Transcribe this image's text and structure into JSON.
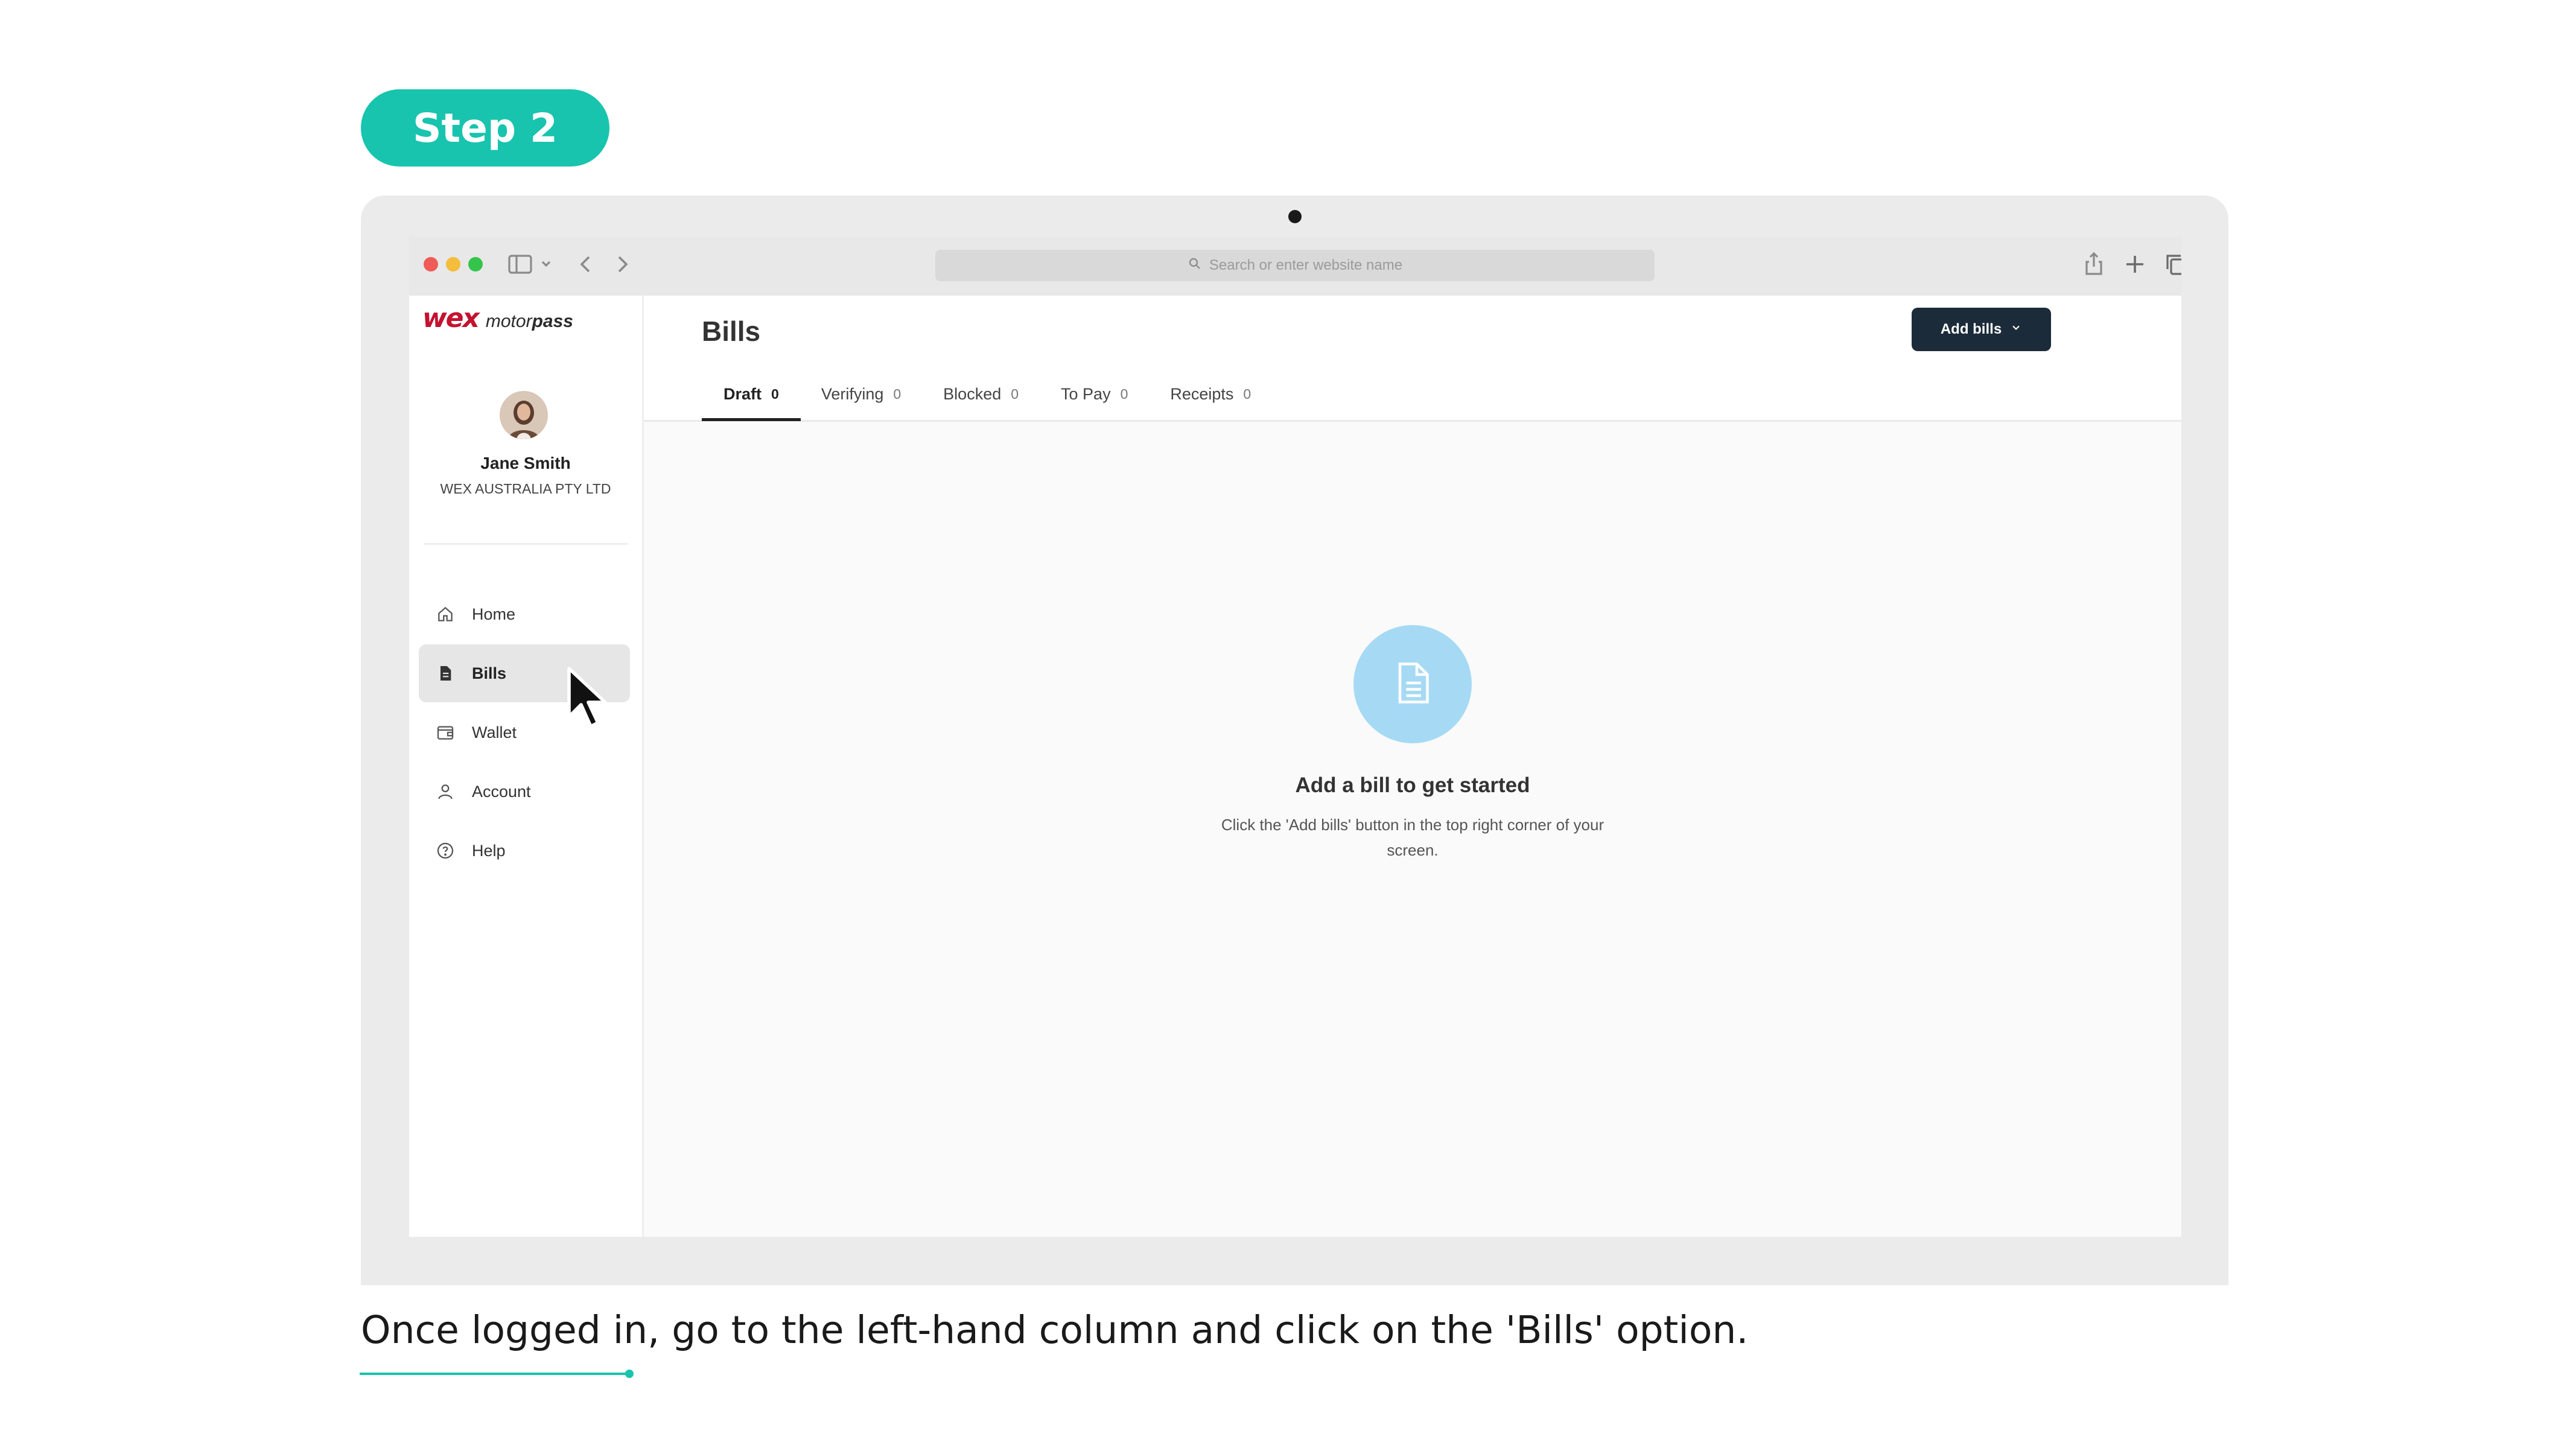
{
  "step": {
    "label": "Step 2"
  },
  "browser": {
    "address_placeholder": "Search or enter website name",
    "icons": [
      "sidebar-toggle-icon",
      "chevron-down-icon",
      "back-icon",
      "forward-icon",
      "search-icon",
      "share-icon",
      "new-tab-icon",
      "tabs-overview-icon"
    ]
  },
  "app": {
    "logo": {
      "wex": "wex",
      "motor": "motor",
      "pass": "pass"
    },
    "user": {
      "name": "Jane Smith",
      "company": "WEX AUSTRALIA PTY LTD"
    },
    "nav": [
      {
        "label": "Home",
        "icon": "home-icon",
        "active": false
      },
      {
        "label": "Bills",
        "icon": "bill-icon",
        "active": true
      },
      {
        "label": "Wallet",
        "icon": "wallet-icon",
        "active": false
      },
      {
        "label": "Account",
        "icon": "user-icon",
        "active": false
      },
      {
        "label": "Help",
        "icon": "help-icon",
        "active": false
      }
    ],
    "header": {
      "title": "Bills",
      "add_button": "Add bills",
      "tabs": [
        {
          "label": "Draft",
          "count": "0",
          "active": true
        },
        {
          "label": "Verifying",
          "count": "0",
          "active": false
        },
        {
          "label": "Blocked",
          "count": "0",
          "active": false
        },
        {
          "label": "To Pay",
          "count": "0",
          "active": false
        },
        {
          "label": "Receipts",
          "count": "0",
          "active": false
        }
      ]
    },
    "empty_state": {
      "title": "Add a bill to get started",
      "description": "Click the 'Add bills' button in the top right corner of your screen.",
      "icon": "document-icon"
    }
  },
  "caption": "Once logged in, go to the left-hand column and click on the 'Bills' option.",
  "colors": {
    "accent": "#18c4ae",
    "brand_red": "#c4122f",
    "button_dark": "#1c2b3a",
    "empty_circle": "#a6daf4"
  }
}
